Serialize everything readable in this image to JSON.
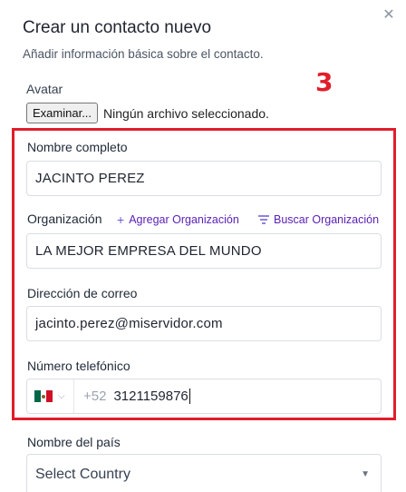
{
  "dialog": {
    "title": "Crear un contacto nuevo",
    "subtitle": "Añadir información básica sobre el contacto.",
    "close_icon": "close-icon",
    "annotation": "3"
  },
  "avatar": {
    "label": "Avatar",
    "button_label": "Examinar...",
    "status": "Ningún archivo seleccionado."
  },
  "fields": {
    "full_name": {
      "label": "Nombre completo",
      "value": "JACINTO PEREZ"
    },
    "organization": {
      "label": "Organización",
      "add_label": "Agregar Organización",
      "add_icon": "plus-icon",
      "search_label": "Buscar Organización",
      "search_icon": "filter-icon",
      "value": "LA MEJOR EMPRESA DEL MUNDO"
    },
    "email": {
      "label": "Dirección de correo",
      "value": "jacinto.perez@miservidor.com"
    },
    "phone": {
      "label": "Número telefónico",
      "country_flag": "mexico-flag-icon",
      "dial_code": "+52",
      "value": "3121159876"
    },
    "country": {
      "label": "Nombre del país",
      "placeholder": "Select Country"
    }
  },
  "colors": {
    "highlight": "#e11d2a",
    "accent": "#5b21b6"
  }
}
